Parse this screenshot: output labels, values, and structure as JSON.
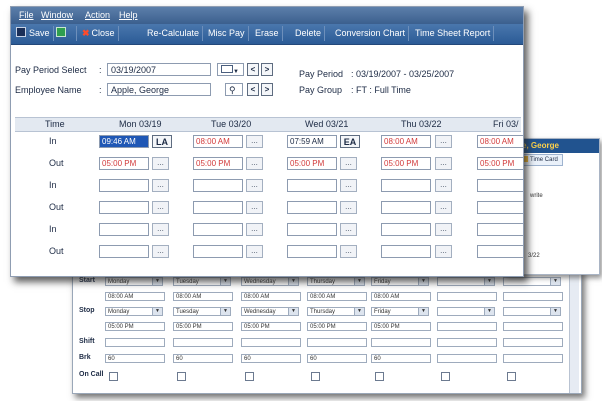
{
  "menu": [
    "File",
    "Window",
    "Action",
    "Help"
  ],
  "toolbar": {
    "save": "Save",
    "close": "Close",
    "recalculate": "Re-Calculate",
    "misc_pay": "Misc Pay",
    "erase": "Erase",
    "delete": "Delete",
    "conversion_chart": "Conversion Chart",
    "time_sheet_report": "Time Sheet Report"
  },
  "form": {
    "pay_period_label": "Pay Period Select",
    "pay_period_colon": ":",
    "pay_period_value": "03/19/2007",
    "employee_label": "Employee Name",
    "employee_colon": ":",
    "employee_value": "Apple, George",
    "pay_period_info_label": "Pay Period",
    "pay_period_info_value": ": 03/19/2007 - 03/25/2007",
    "pay_group_label": "Pay Group",
    "pay_group_value": ": FT : Full Time",
    "prev": "<",
    "next": ">"
  },
  "grid": {
    "time_header": "Time",
    "days": [
      "Mon 03/19",
      "Tue 03/20",
      "Wed 03/21",
      "Thu 03/22",
      "Fri 03/"
    ],
    "row_labels": [
      "In",
      "Out",
      "In",
      "Out",
      "In",
      "Out"
    ],
    "in1": [
      "09:46 AM",
      "08:00 AM",
      "07:59 AM",
      "08:00 AM",
      "08:00 AM"
    ],
    "out1": [
      "05:00 PM",
      "05:00 PM",
      "05:00 PM",
      "05:00 PM",
      "05:00 PM"
    ],
    "codes": [
      "LA",
      "EA"
    ],
    "ellipsis": "..."
  },
  "mid_window": {
    "employee": "ople, George",
    "tab": "Time Card",
    "write": "write",
    "date": "3/22"
  },
  "back_window": {
    "start_label": "Start",
    "stop_label": "Stop",
    "shift_label": "Shift",
    "brk_label": "Brk",
    "oncall_label": "On Call",
    "days": [
      "Monday",
      "Tuesday",
      "Wednesday",
      "Thursday",
      "Friday"
    ],
    "start_times": [
      "08:00 AM",
      "08:00 AM",
      "08:00 AM",
      "08:00 AM",
      "08:00 AM"
    ],
    "stop_times": [
      "05:00 PM",
      "05:00 PM",
      "05:00 PM",
      "05:00 PM",
      "05:00 PM"
    ],
    "brk_values": [
      "60",
      "60",
      "60",
      "60",
      "60"
    ]
  },
  "colors": {
    "toolbar": "#2b5b96",
    "accent_red": "#d23a3a",
    "selection": "#1f57b5",
    "name_highlight": "#ffd24a"
  }
}
